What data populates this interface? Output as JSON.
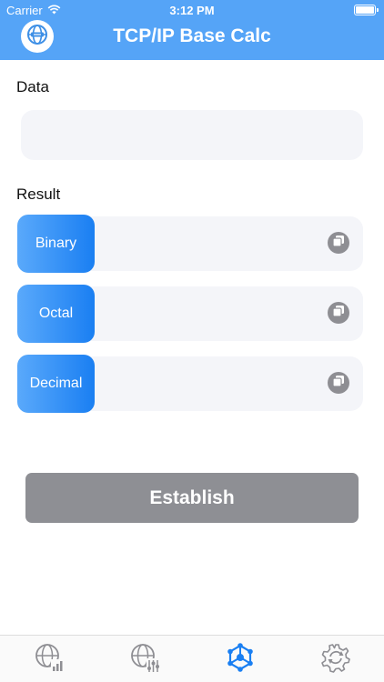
{
  "status_bar": {
    "carrier": "Carrier",
    "time": "3:12 PM"
  },
  "nav": {
    "title": "TCP/IP Base Calc",
    "logo_icon": "globe-icon"
  },
  "data_section": {
    "label": "Data",
    "value": "",
    "placeholder": ""
  },
  "result_section": {
    "label": "Result",
    "rows": [
      {
        "label": "Binary",
        "value": ""
      },
      {
        "label": "Octal",
        "value": ""
      },
      {
        "label": "Decimal",
        "value": ""
      }
    ]
  },
  "establish_button": {
    "label": "Establish"
  },
  "tabs": [
    {
      "icon": "globe-chart-icon",
      "active": false
    },
    {
      "icon": "globe-sliders-icon",
      "active": false
    },
    {
      "icon": "network-hub-icon",
      "active": true
    },
    {
      "icon": "settings-icon",
      "active": false
    }
  ],
  "colors": {
    "header": "#55a4f7",
    "tag_gradient_start": "#5aa9fb",
    "tag_gradient_end": "#1a7ff2",
    "button": "#8e8f94",
    "tab_active": "#1a7ff2",
    "tab_inactive": "#8e8e93"
  }
}
